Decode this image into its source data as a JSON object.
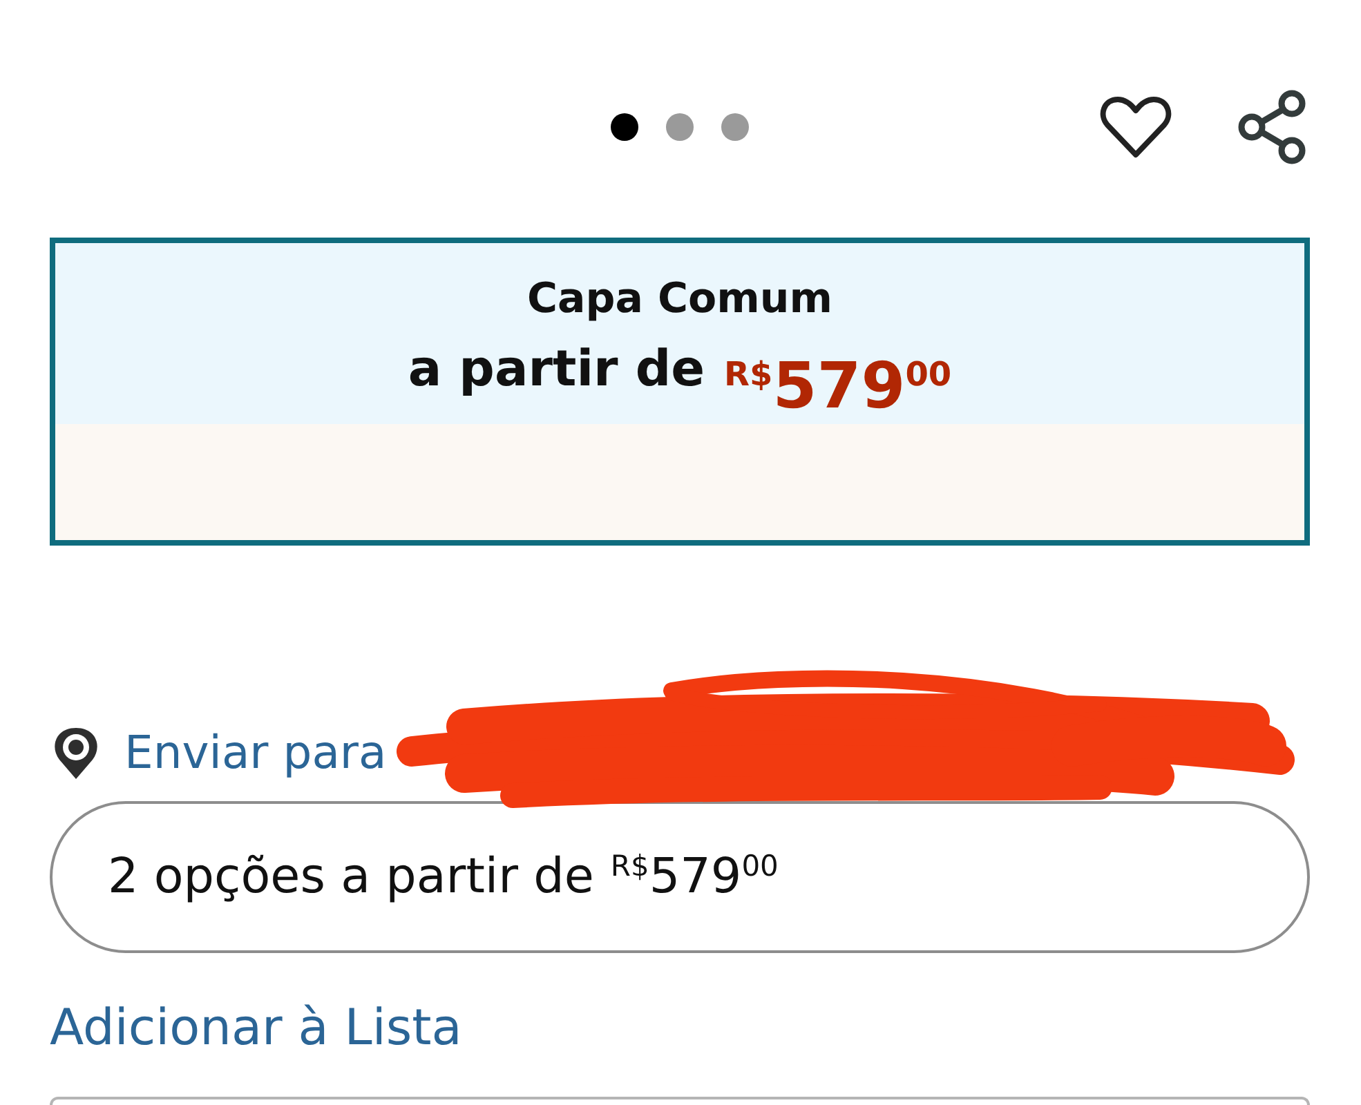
{
  "carousel": {
    "dots": [
      {
        "selected": true
      },
      {
        "selected": false
      },
      {
        "selected": false
      }
    ]
  },
  "format_card": {
    "title": "Capa Comum",
    "price_label": "a partir de",
    "price": {
      "currency": "R$",
      "whole": "579",
      "cents": "00"
    }
  },
  "delivery": {
    "label": "Enviar para"
  },
  "options_button": {
    "text": "2 opções a partir de",
    "price": {
      "currency": "R$",
      "whole": "579",
      "cents": "00"
    }
  },
  "add_to_list": {
    "label": "Adicionar à Lista"
  }
}
